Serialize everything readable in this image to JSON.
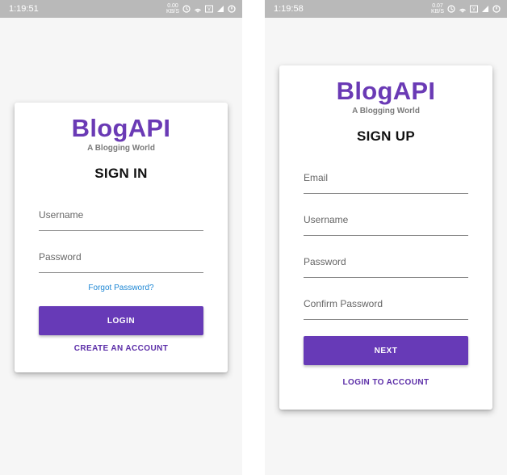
{
  "colors": {
    "brand": "#673ab7",
    "link": "#1c86d4",
    "statusbar": "#b9b9b9"
  },
  "left": {
    "status": {
      "time": "1:19:51",
      "speed_value": "0.00",
      "speed_unit": "KB/S"
    },
    "logo": "BlogAPI",
    "tagline": "A Blogging World",
    "heading": "SIGN IN",
    "username_placeholder": "Username",
    "password_placeholder": "Password",
    "forgot_link": "Forgot Password?",
    "login_button": "LOGIN",
    "create_account": "CREATE AN ACCOUNT"
  },
  "right": {
    "status": {
      "time": "1:19:58",
      "speed_value": "0.07",
      "speed_unit": "KB/S"
    },
    "logo": "BlogAPI",
    "tagline": "A Blogging World",
    "heading": "SIGN UP",
    "email_placeholder": "Email",
    "username_placeholder": "Username",
    "password_placeholder": "Password",
    "confirm_placeholder": "Confirm Password",
    "next_button": "NEXT",
    "login_account": "LOGIN TO ACCOUNT"
  },
  "status_icons": [
    "clock-icon",
    "wifi-hotspot-icon",
    "volte-icon",
    "signal-icon",
    "battery-icon"
  ]
}
